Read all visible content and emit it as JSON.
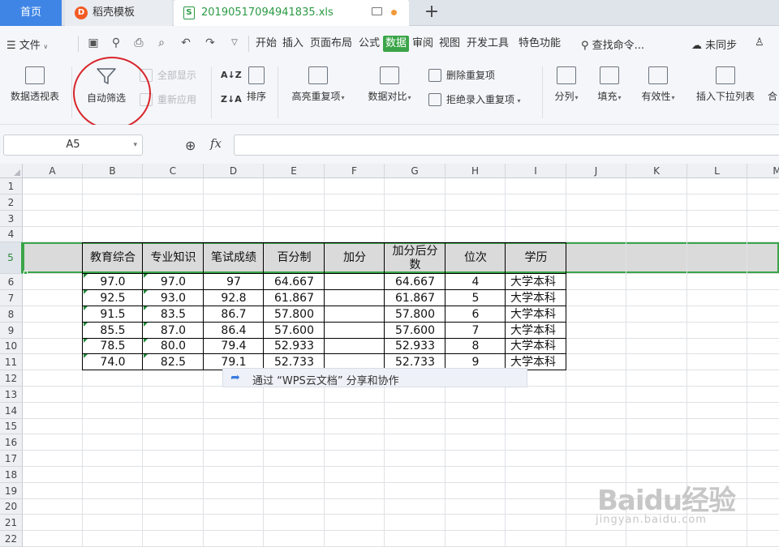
{
  "tabs": {
    "home": "首页",
    "daoke": "稻壳模板",
    "file": "20190517094941835.xls",
    "add": "+"
  },
  "menu": {
    "file": "文件",
    "items": [
      "开始",
      "插入",
      "页面布局",
      "公式",
      "数据",
      "审阅",
      "视图",
      "开发工具",
      "特色功能"
    ],
    "active": "数据",
    "search": "查找命令...",
    "sync": "未同步"
  },
  "ribbon": {
    "pivot": "数据透视表",
    "autofilter": "自动筛选",
    "show_all": "全部显示",
    "reapply": "重新应用",
    "sort": "排序",
    "highlight_dup": "高亮重复项",
    "compare": "数据对比",
    "delete_dup": "删除重复项",
    "reject_dup": "拒绝录入重复项",
    "split": "分列",
    "fill": "填充",
    "validity": "有效性",
    "dropdown": "插入下拉列表",
    "merge": "合"
  },
  "formula_bar": {
    "cell_ref": "A5",
    "fx": "fx",
    "content": ""
  },
  "columns": [
    "A",
    "B",
    "C",
    "D",
    "E",
    "F",
    "G",
    "H",
    "I",
    "J",
    "K",
    "L",
    "M"
  ],
  "rows": [
    "1",
    "2",
    "3",
    "4",
    "5",
    "6",
    "7",
    "8",
    "9",
    "10",
    "11",
    "12",
    "13",
    "14",
    "15",
    "16",
    "17",
    "18",
    "19",
    "20",
    "21",
    "22"
  ],
  "table": {
    "headers": [
      "教育综合",
      "专业知识",
      "笔试成绩",
      "百分制",
      "加分",
      "加分后分数",
      "位次",
      "学历"
    ],
    "rows": [
      [
        "97.0",
        "97.0",
        "97",
        "64.667",
        "",
        "64.667",
        "4",
        "大学本科"
      ],
      [
        "92.5",
        "93.0",
        "92.8",
        "61.867",
        "",
        "61.867",
        "5",
        "大学本科"
      ],
      [
        "91.5",
        "83.5",
        "86.7",
        "57.800",
        "",
        "57.800",
        "6",
        "大学本科"
      ],
      [
        "85.5",
        "87.0",
        "86.4",
        "57.600",
        "",
        "57.600",
        "7",
        "大学本科"
      ],
      [
        "78.5",
        "80.0",
        "79.4",
        "52.933",
        "",
        "52.933",
        "8",
        "大学本科"
      ],
      [
        "74.0",
        "82.5",
        "79.1",
        "52.733",
        "",
        "52.733",
        "9",
        "大学本科"
      ]
    ]
  },
  "share_popup": "通过 “WPS云文档” 分享和协作",
  "watermark": {
    "main": "Baidu经验",
    "sub": "jingyan.baidu.com"
  }
}
